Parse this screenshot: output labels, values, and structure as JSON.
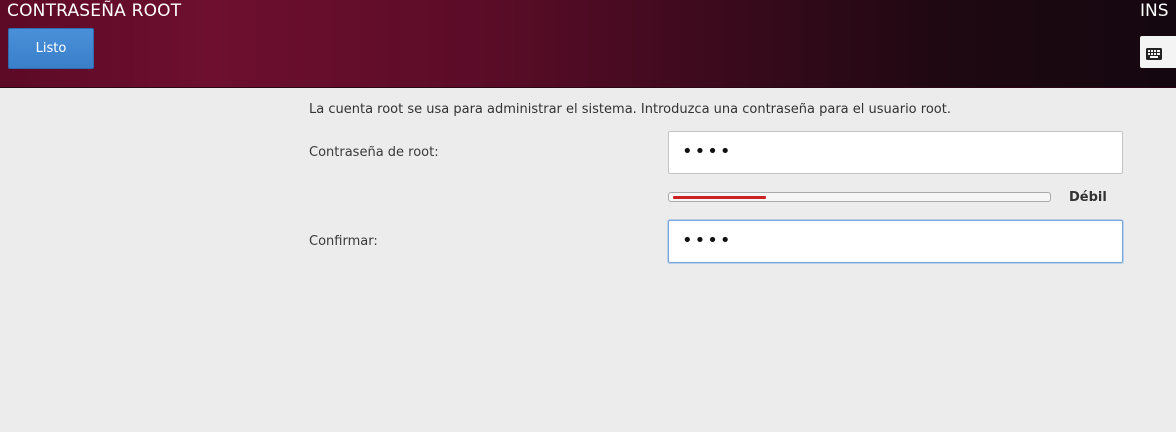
{
  "header": {
    "title": "CONTRASEÑA ROOT",
    "done_label": "Listo",
    "installer_label": "INS",
    "keyboard_layout_icon": "keyboard-icon"
  },
  "main": {
    "intro_text": "La cuenta root se usa para administrar el sistema. Introduzca una contraseña para el usuario root.",
    "password": {
      "label": "Contraseña de root:",
      "value": "••••"
    },
    "strength": {
      "level": 0.25,
      "label": "Débil",
      "color": "#cc2222"
    },
    "confirm": {
      "label": "Confirmar:",
      "value": "••••"
    }
  },
  "colors": {
    "header_start": "#6e0f2f",
    "header_end": "#140710",
    "button_blue": "#3a7fc9",
    "background": "#ececec"
  }
}
